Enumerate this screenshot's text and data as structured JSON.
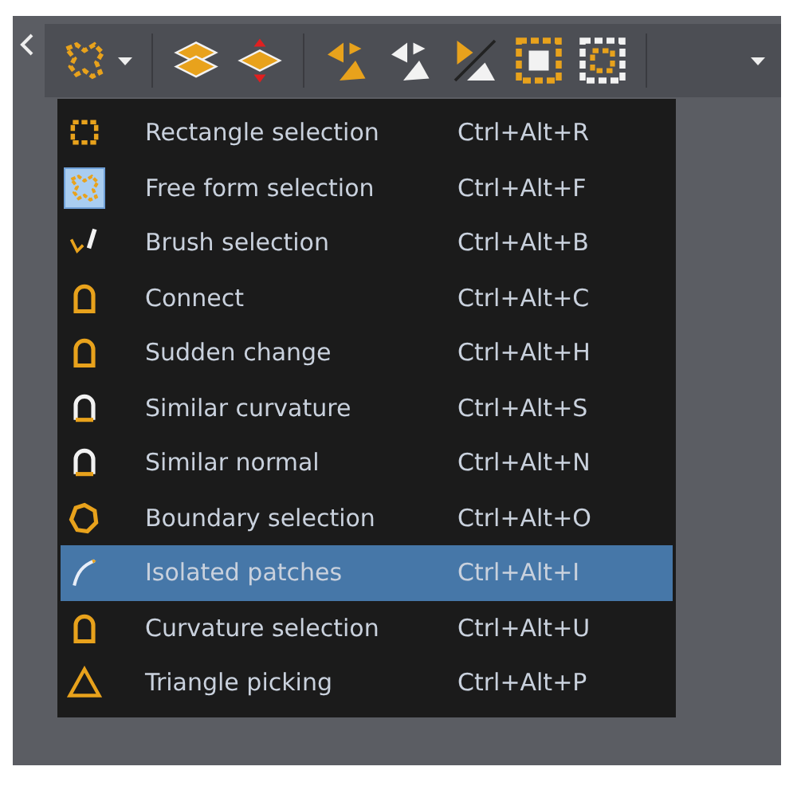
{
  "toolbar": {
    "buttons": [
      {
        "kind": "freeform",
        "dropdown": true
      },
      {
        "kind": "separator"
      },
      {
        "kind": "layers"
      },
      {
        "kind": "split-layers"
      },
      {
        "kind": "separator"
      },
      {
        "kind": "triangles-orange"
      },
      {
        "kind": "triangles-white"
      },
      {
        "kind": "triangles-diagonal"
      },
      {
        "kind": "grow-selection"
      },
      {
        "kind": "shrink-selection"
      },
      {
        "kind": "separator"
      },
      {
        "kind": "overflow",
        "dropdown": true
      }
    ]
  },
  "menu": {
    "items": [
      {
        "kind": "rect",
        "label": "Rectangle selection",
        "shortcut": "Ctrl+Alt+R",
        "selected": false,
        "checked": false
      },
      {
        "kind": "freeform",
        "label": "Free form selection",
        "shortcut": "Ctrl+Alt+F",
        "selected": false,
        "checked": true
      },
      {
        "kind": "brush",
        "label": "Brush selection",
        "shortcut": "Ctrl+Alt+B",
        "selected": false,
        "checked": false
      },
      {
        "kind": "arch",
        "label": "Connect",
        "shortcut": "Ctrl+Alt+C",
        "selected": false,
        "checked": false
      },
      {
        "kind": "arch",
        "label": "Sudden change",
        "shortcut": "Ctrl+Alt+H",
        "selected": false,
        "checked": false
      },
      {
        "kind": "arch-white",
        "label": "Similar curvature",
        "shortcut": "Ctrl+Alt+S",
        "selected": false,
        "checked": false
      },
      {
        "kind": "arch-white",
        "label": "Similar normal",
        "shortcut": "Ctrl+Alt+N",
        "selected": false,
        "checked": false
      },
      {
        "kind": "ring",
        "label": "Boundary selection",
        "shortcut": "Ctrl+Alt+O",
        "selected": false,
        "checked": false
      },
      {
        "kind": "stroke",
        "label": "Isolated patches",
        "shortcut": "Ctrl+Alt+I",
        "selected": true,
        "checked": false
      },
      {
        "kind": "arch",
        "label": "Curvature selection",
        "shortcut": "Ctrl+Alt+U",
        "selected": false,
        "checked": false
      },
      {
        "kind": "triangle",
        "label": "Triangle picking",
        "shortcut": "Ctrl+Alt+P",
        "selected": false,
        "checked": false
      }
    ]
  }
}
